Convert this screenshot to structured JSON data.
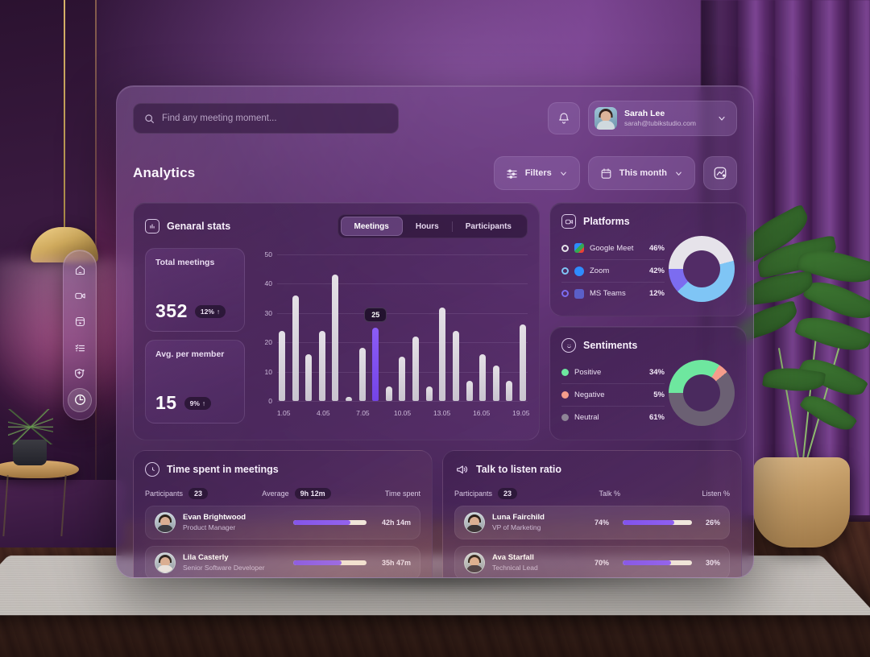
{
  "app": {
    "search": {
      "placeholder": "Find any meeting moment...",
      "value": "",
      "icon": "search-icon"
    },
    "notifications_icon": "bell-icon",
    "profile": {
      "name": "Sarah Lee",
      "email": "sarah@tubikstudio.com",
      "chevron": "chevron-down-icon"
    },
    "page_title": "Analytics",
    "controls": {
      "filters_label": "Filters",
      "filters_icon": "sliders-icon",
      "period_label": "This month",
      "period_icon": "calendar-icon",
      "export_icon": "chart-export-icon"
    }
  },
  "sidebar": {
    "items": [
      {
        "name": "home",
        "icon": "home-icon",
        "active": false
      },
      {
        "name": "meetings",
        "icon": "video-camera-icon",
        "active": false
      },
      {
        "name": "recordings",
        "icon": "recordings-icon",
        "active": false
      },
      {
        "name": "tasks",
        "icon": "list-icon",
        "active": false
      },
      {
        "name": "ai-insights",
        "icon": "sparkle-shield-icon",
        "active": false
      },
      {
        "name": "analytics",
        "icon": "clock-analytics-icon",
        "active": true
      }
    ]
  },
  "general_stats": {
    "title": "Genaral stats",
    "icon": "bar-chart-icon",
    "tabs": [
      {
        "label": "Meetings",
        "active": true
      },
      {
        "label": "Hours",
        "active": false
      },
      {
        "label": "Participants",
        "active": false
      }
    ],
    "stats": [
      {
        "label": "Total meetings",
        "value": "352",
        "delta": "12%",
        "trend": "↑"
      },
      {
        "label": "Avg. per member",
        "value": "15",
        "delta": "9%",
        "trend": "↑"
      }
    ]
  },
  "chart_data": {
    "type": "bar",
    "title": "Genaral stats — Meetings",
    "xlabel": "",
    "ylabel": "",
    "ylim": [
      0,
      50
    ],
    "yticks": [
      0,
      10,
      20,
      30,
      40,
      50
    ],
    "grid": true,
    "legend": "none",
    "tick_labels": [
      "1.05",
      "4.05",
      "7.05",
      "10.05",
      "13.05",
      "16.05",
      "19.05"
    ],
    "tick_indices": [
      0,
      3,
      6,
      9,
      12,
      15,
      18
    ],
    "categories": [
      "1.05",
      "2.05",
      "3.05",
      "4.05",
      "5.05",
      "6.05",
      "7.05",
      "8.05",
      "9.05",
      "10.05",
      "11.05",
      "12.05",
      "13.05",
      "14.05",
      "15.05",
      "16.05",
      "17.05",
      "18.05",
      "19.05"
    ],
    "values": [
      24,
      36,
      16,
      24,
      43,
      1.5,
      18,
      25,
      5,
      15,
      22,
      5,
      32,
      24,
      7,
      16,
      12,
      7,
      26
    ],
    "highlight_index": 7,
    "highlight_label": "25",
    "bar_color": "#d6d1da",
    "highlight_color": "#8b5cf6"
  },
  "platforms": {
    "title": "Platforms",
    "icon": "video-camera-icon",
    "chart_data": {
      "type": "pie",
      "title": "Platforms",
      "labels": [
        "Google Meet",
        "Zoom",
        "MS Teams"
      ],
      "values": [
        46,
        42,
        12
      ],
      "colors": [
        "#e6e3ea",
        "#7fc5f5",
        "#7c6cf0"
      ]
    },
    "rows": [
      {
        "name": "Google Meet",
        "value": "46%",
        "dot": "#e6e3ea",
        "app_icon": "google-meet-icon"
      },
      {
        "name": "Zoom",
        "value": "42%",
        "dot": "#7fc5f5",
        "app_icon": "zoom-icon"
      },
      {
        "name": "MS Teams",
        "value": "12%",
        "dot": "#7c6cf0",
        "app_icon": "ms-teams-icon"
      }
    ]
  },
  "sentiments": {
    "title": "Sentiments",
    "icon": "smiley-icon",
    "chart_data": {
      "type": "pie",
      "title": "Sentiments",
      "labels": [
        "Positive",
        "Negative",
        "Neutral"
      ],
      "values": [
        34,
        5,
        61
      ],
      "colors": [
        "#6ee79f",
        "#f59d8b",
        "#6b6073"
      ]
    },
    "rows": [
      {
        "name": "Positive",
        "value": "34%",
        "dot": "#6ee79f"
      },
      {
        "name": "Negative",
        "value": "5%",
        "dot": "#f59d8b"
      },
      {
        "name": "Neutral",
        "value": "61%",
        "dot": "#8e8496"
      }
    ]
  },
  "time_spent": {
    "title": "Time spent in meetings",
    "icon": "clock-icon",
    "meta": {
      "participants_label": "Participants",
      "participants_value": "23",
      "average_label": "Average",
      "average_value": "9h 12m",
      "column_label": "Time spent"
    },
    "rows": [
      {
        "name": "Evan Brightwood",
        "role": "Product Manager",
        "progress": 78,
        "value": "42h 14m"
      },
      {
        "name": "Lila Casterly",
        "role": "Senior Software Developer",
        "progress": 66,
        "value": "35h 47m"
      }
    ]
  },
  "talk_ratio": {
    "title": "Talk to listen ratio",
    "icon": "megaphone-icon",
    "meta": {
      "participants_label": "Participants",
      "participants_value": "23",
      "talk_label": "Talk %",
      "listen_label": "Listen %"
    },
    "rows": [
      {
        "name": "Luna Fairchild",
        "role": "VP of Marketing",
        "talk": "74%",
        "listen": "26%",
        "progress": 74
      },
      {
        "name": "Ava Starfall",
        "role": "Technical Lead",
        "talk": "70%",
        "listen": "30%",
        "progress": 70
      }
    ]
  },
  "theme": {
    "accent": "#8b5cf6",
    "panel": "#6b3f85",
    "bg_wall": "#5b2b68",
    "text": "#f2e9f7"
  }
}
